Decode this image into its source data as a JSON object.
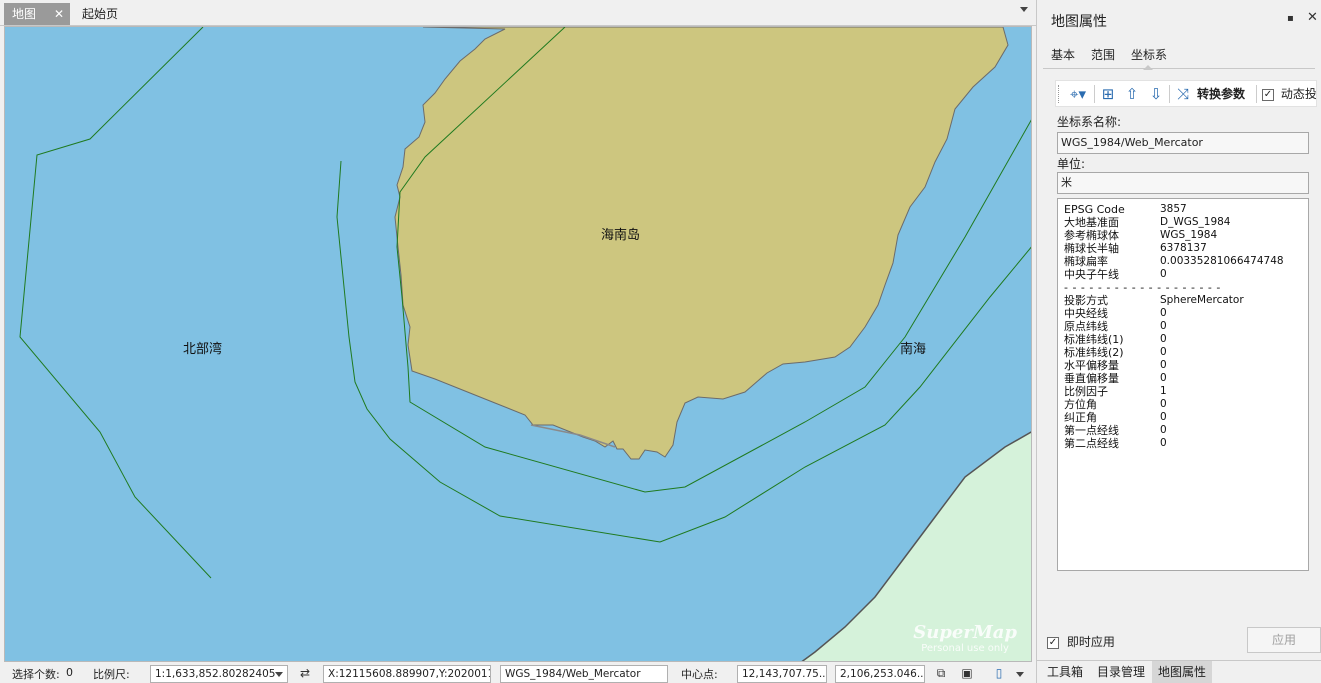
{
  "doc_tabs": {
    "map_tab": "地图",
    "close_symbol": "✕",
    "start_tab": "起始页"
  },
  "map": {
    "labels": {
      "beibu_gulf": "北部湾",
      "hainan_island": "海南岛",
      "south_sea": "南海"
    },
    "watermark": {
      "brand": "SuperMap",
      "subtitle": "Personal use only"
    },
    "colors": {
      "water": "#80c1e3",
      "land": "#cdc67f",
      "mainland": "#d5f2da",
      "boundary": "#1f7a1f"
    }
  },
  "panel": {
    "title": "地图属性",
    "pin_symbol": "▪",
    "close_symbol": "✕",
    "tabs": [
      "基本",
      "范围",
      "坐标系"
    ],
    "active_tab": "坐标系",
    "toolbar": {
      "convert_label": "转换参数",
      "dynamic_label": "动态投",
      "icons": [
        "coordinate-system-icon",
        "new-coordinate-icon",
        "import-icon",
        "export-icon",
        "convert-icon"
      ]
    },
    "cs_name_label": "坐标系名称:",
    "cs_name_value": "WGS_1984/Web_Mercator",
    "unit_label": "单位:",
    "unit_value": "米",
    "info": {
      "rows_top": [
        {
          "k": "EPSG Code",
          "v": "3857"
        },
        {
          "k": "大地基准面",
          "v": "D_WGS_1984"
        },
        {
          "k": "参考椭球体",
          "v": "WGS_1984"
        },
        {
          "k": "椭球长半轴",
          "v": "6378137"
        },
        {
          "k": "椭球扁率",
          "v": "0.00335281066474748"
        },
        {
          "k": "中央子午线",
          "v": "0"
        }
      ],
      "separator": "- - - - - - - - - - - - - - - - - - -",
      "rows_bottom": [
        {
          "k": "投影方式",
          "v": "SphereMercator"
        },
        {
          "k": "中央经线",
          "v": "0"
        },
        {
          "k": "原点纬线",
          "v": "0"
        },
        {
          "k": "标准纬线(1)",
          "v": "0"
        },
        {
          "k": "标准纬线(2)",
          "v": "0"
        },
        {
          "k": "水平偏移量",
          "v": "0"
        },
        {
          "k": "垂直偏移量",
          "v": "0"
        },
        {
          "k": "比例因子",
          "v": "1"
        },
        {
          "k": "方位角",
          "v": "0"
        },
        {
          "k": "纠正角",
          "v": "0"
        },
        {
          "k": "第一点经线",
          "v": "0"
        },
        {
          "k": "第二点经线",
          "v": "0"
        }
      ]
    },
    "apply_now_label": "即时应用",
    "apply_now_checked": true,
    "apply_button": "应用",
    "bottom_tabs": [
      "工具箱",
      "目录管理",
      "地图属性"
    ],
    "active_bottom_tab": "地图属性"
  },
  "status": {
    "selected_label": "选择个数:",
    "selected_value": "0",
    "scale_label": "比例尺:",
    "scale_value": "1:1,633,852.80282405",
    "coords_value": "X:12115608.889907,Y:2020011...",
    "cs_value": "WGS_1984/Web_Mercator",
    "center_label": "中心点:",
    "center_x": "12,143,707.75...",
    "center_y": "2,106,253.046..."
  }
}
